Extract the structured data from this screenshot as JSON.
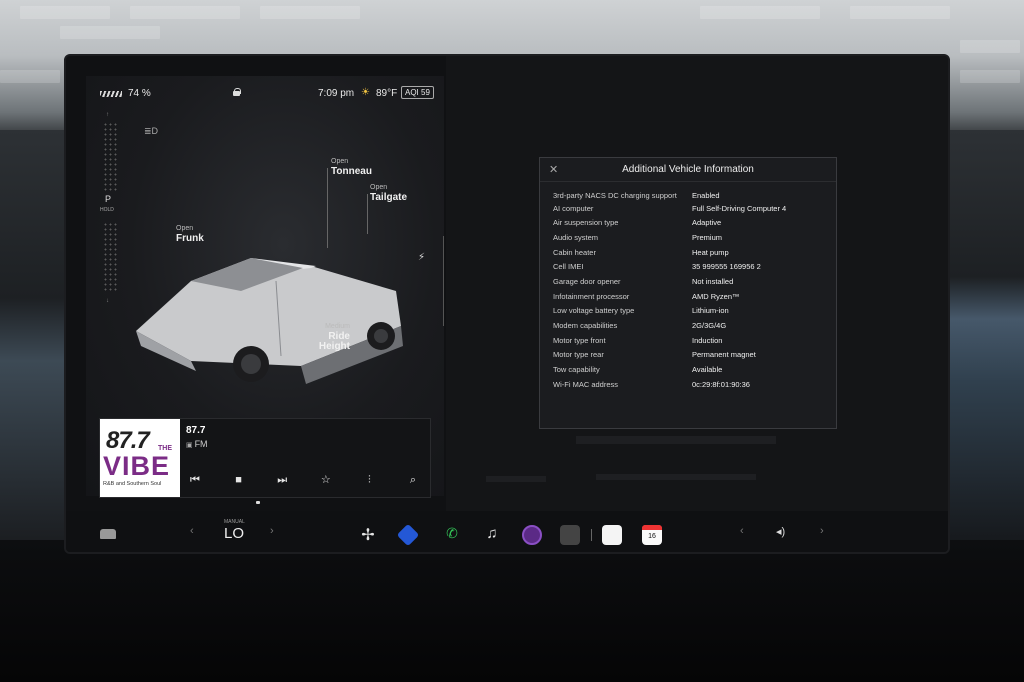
{
  "status_bar": {
    "battery": "74 %",
    "time": "7:09 pm",
    "temperature": "89°F",
    "aqi": "AQI 59"
  },
  "gear": {
    "current": "P",
    "hold": "HOLD"
  },
  "vehicle": {
    "tonneau": {
      "state": "Open",
      "label": "Tonneau"
    },
    "tailgate": {
      "state": "Open",
      "label": "Tailgate"
    },
    "frunk": {
      "state": "Open",
      "label": "Frunk"
    },
    "ride_height": {
      "state": "Medium",
      "label": "Ride Height"
    }
  },
  "media": {
    "art": {
      "number": "87.7",
      "the": "THE",
      "name": "VIBE",
      "tagline": "R&B and Southern Soul"
    },
    "station": "87.7",
    "band": "FM"
  },
  "info_panel": {
    "title": "Additional Vehicle Information",
    "rows": [
      {
        "key": "3rd-party NACS DC charging support",
        "value": "Enabled"
      },
      {
        "key": "AI computer",
        "value": "Full Self-Driving Computer 4"
      },
      {
        "key": "Air suspension type",
        "value": "Adaptive"
      },
      {
        "key": "Audio system",
        "value": "Premium"
      },
      {
        "key": "Cabin heater",
        "value": "Heat pump"
      },
      {
        "key": "Cell IMEI",
        "value": "35 999555 169956 2"
      },
      {
        "key": "Garage door opener",
        "value": "Not installed"
      },
      {
        "key": "Infotainment processor",
        "value": "AMD Ryzen™"
      },
      {
        "key": "Low voltage battery type",
        "value": "Lithium-ion"
      },
      {
        "key": "Modem capabilities",
        "value": "2G/3G/4G"
      },
      {
        "key": "Motor type front",
        "value": "Induction"
      },
      {
        "key": "Motor type rear",
        "value": "Permanent magnet"
      },
      {
        "key": "Tow capability",
        "value": "Available"
      },
      {
        "key": "Wi-Fi MAC address",
        "value": "0c:29:8f:01:90:36"
      }
    ]
  },
  "dock": {
    "climate_mode": "MANUAL",
    "climate_temp": "LO",
    "calendar_day": "16"
  },
  "colors": {
    "accent_purple": "#7b2c86",
    "aqi_border": "#aaaaaa",
    "sun": "#f4c542",
    "phone": "#34c759"
  }
}
